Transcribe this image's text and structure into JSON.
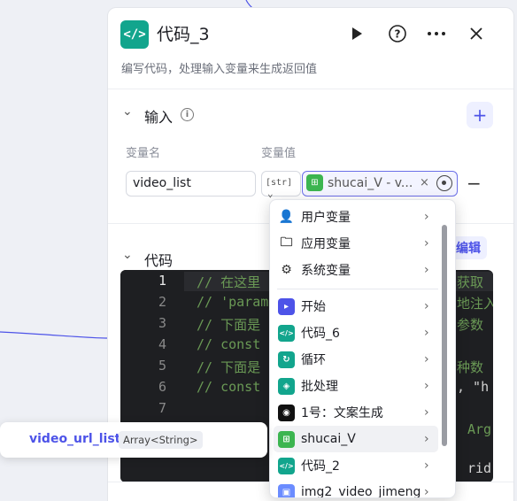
{
  "node": {
    "title": "代码_3",
    "description": "编写代码，处理输入变量来生成返回值",
    "logo_text": "</>",
    "icons": [
      "play-icon",
      "help-icon",
      "more-icon",
      "close-icon"
    ]
  },
  "input_section": {
    "label": "输入",
    "col_name": "变量名",
    "col_value": "变量值",
    "row": {
      "name": "video_list",
      "type": "[str]",
      "value_text": "shucai_V - v...",
      "clear": "×",
      "minus": "−"
    },
    "plus": "+"
  },
  "code_section": {
    "label": "代码",
    "edit_label": "编辑",
    "line_numbers": [
      "1",
      "2",
      "3",
      "4",
      "5",
      "6",
      "7"
    ],
    "lines": [
      {
        "text": "// 在这里",
        "tail": "获取"
      },
      {
        "text": "// 'param",
        "tail": "地注入"
      },
      {
        "text": "// 下面是",
        "tail": "参数"
      },
      {
        "text": "// const",
        "tail": ""
      },
      {
        "text": "// 下面是",
        "tail": "种数"
      },
      {
        "text": "// const",
        "tail": ", \"h"
      },
      {
        "text": "",
        "tail": ""
      }
    ],
    "partial_right": [
      "Arg",
      "rid"
    ]
  },
  "dropdown": {
    "items": [
      {
        "label": "用户变量",
        "icon": "user-icon",
        "glyph": "👤"
      },
      {
        "label": "应用变量",
        "icon": "folder-icon",
        "glyph": "🗀"
      },
      {
        "label": "系统变量",
        "icon": "gear-icon",
        "glyph": "⚙"
      },
      {
        "label": "开始",
        "icon": "start-icon",
        "glyph": "▸",
        "color": "#4d53e8"
      },
      {
        "label": "代码_6",
        "icon": "code-icon",
        "glyph": "</>",
        "color": "#12a58d"
      },
      {
        "label": "循环",
        "icon": "loop-icon",
        "glyph": "↻",
        "color": "#12a58d"
      },
      {
        "label": "批处理",
        "icon": "batch-icon",
        "glyph": "◈",
        "color": "#12a58d"
      },
      {
        "label": "1号：文案生成",
        "icon": "agent-icon",
        "glyph": "◉",
        "color": "#111111"
      },
      {
        "label": "shucai_V",
        "icon": "workflow-icon",
        "glyph": "⊞",
        "color": "#3cb550"
      },
      {
        "label": "代码_2",
        "icon": "code-icon",
        "glyph": "</>",
        "color": "#12a58d"
      },
      {
        "label": "img2_video_jimeng",
        "icon": "image-video-icon",
        "glyph": "▣",
        "color": "#6b8cff"
      }
    ]
  },
  "tooltip": {
    "name": "video_url_list",
    "type": "Array<String>"
  },
  "colors": {
    "accent": "#4d53e8",
    "code_logo": "#12a58d",
    "workflow_green": "#3cb550"
  }
}
